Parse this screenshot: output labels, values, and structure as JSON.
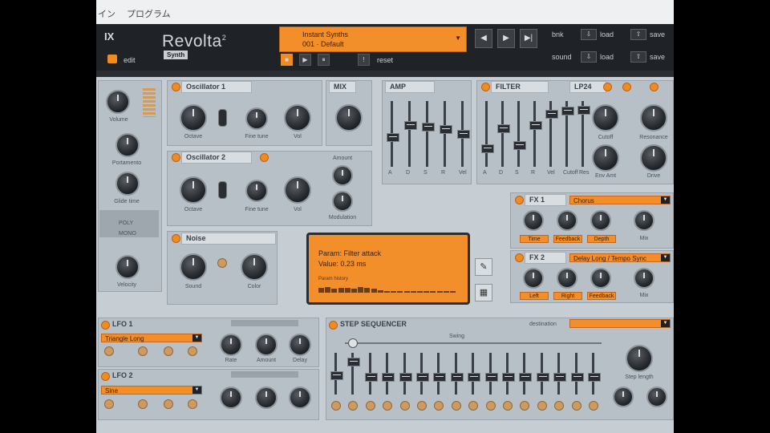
{
  "window": {
    "menu": [
      "イン",
      "プログラム"
    ]
  },
  "header": {
    "brand": "IX",
    "product": "Revolta",
    "product_sup": "2",
    "product_sub": "Synth",
    "edit_label": "edit",
    "preset_line1": "Instant Synths",
    "preset_line2": "001 · Default",
    "reset_label": "reset",
    "nav_buttons": [
      "◀",
      "▶",
      "▶|"
    ],
    "side_rows": [
      {
        "label": "bnk",
        "btn1": "load",
        "btn2": "save"
      },
      {
        "label": "sound",
        "btn1": "load",
        "btn2": "save"
      }
    ],
    "transport": [
      "■",
      "▶",
      "⏸"
    ]
  },
  "osc1": {
    "title": "Oscillator 1",
    "knobs": [
      "Octave",
      "Fine tune",
      "Vol"
    ]
  },
  "mix": {
    "title": "MIX"
  },
  "osc2": {
    "title": "Oscillator 2",
    "knobs": [
      "Octave",
      "Fine tune",
      "Vol",
      "Amount",
      "Modulation"
    ]
  },
  "noise": {
    "title": "Noise",
    "knobs": [
      "Sound",
      "Color"
    ]
  },
  "amp": {
    "title": "AMP",
    "faders": [
      "A",
      "D",
      "S",
      "R",
      "Vel"
    ],
    "levels": [
      0.45,
      0.65,
      0.62,
      0.58,
      0.5
    ]
  },
  "filter": {
    "title": "FILTER",
    "mode": "LP24",
    "faders": [
      "A",
      "D",
      "S",
      "R",
      "Vel",
      "Cutoff",
      "Res"
    ],
    "levels": [
      0.25,
      0.6,
      0.3,
      0.65,
      0.85,
      0.9,
      0.92
    ],
    "knobs": [
      "Cutoff",
      "Resonance",
      "Env Amt",
      "Drive"
    ]
  },
  "fx1": {
    "title": "FX 1",
    "preset": "Chorus",
    "knobs": [
      "Time",
      "Feedback",
      "Depth",
      "Mix"
    ]
  },
  "fx2": {
    "title": "FX 2",
    "preset": "Delay Long / Tempo Sync",
    "knobs": [
      "Left",
      "Right",
      "Feedback",
      "Mix"
    ]
  },
  "lcd": {
    "line1": "Param:  Filter attack",
    "line2": "Value:   0.23 ms",
    "line3": "Param history",
    "bars": [
      0.6,
      0.7,
      0.5,
      0.65,
      0.6,
      0.55,
      0.7,
      0.6,
      0.5,
      0.3,
      0.25,
      0.2,
      0.2,
      0.2,
      0.2,
      0.2,
      0.2,
      0.2,
      0.2,
      0.2,
      0.2
    ]
  },
  "left": {
    "knobs": [
      "Volume",
      "Portamento",
      "Glide time",
      "Velocity"
    ],
    "voice_label": "POLY",
    "mono_label": "MONO"
  },
  "lfo1": {
    "title": "LFO 1",
    "preset": "Triangle Long",
    "knobs": [
      "Rate",
      "Amount",
      "Delay"
    ]
  },
  "lfo2": {
    "title": "LFO 2",
    "preset": "Sine"
  },
  "seq": {
    "title": "STEP SEQUENCER",
    "dest_label": "destination",
    "dest_value": "",
    "swing_label": "Swing",
    "length_label": "Step length",
    "steps": 16,
    "levels": [
      0.45,
      0.85,
      0.4,
      0.4,
      0.4,
      0.4,
      0.4,
      0.4,
      0.4,
      0.4,
      0.4,
      0.4,
      0.4,
      0.4,
      0.4,
      0.4
    ]
  }
}
